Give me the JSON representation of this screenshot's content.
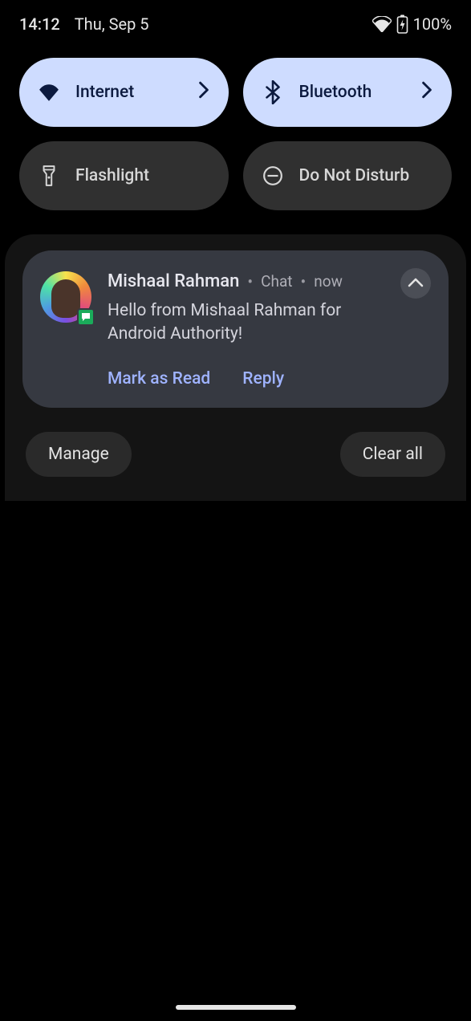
{
  "status": {
    "time": "14:12",
    "date": "Thu, Sep 5",
    "battery": "100%"
  },
  "qs": {
    "internet": "Internet",
    "bluetooth": "Bluetooth",
    "flashlight": "Flashlight",
    "dnd": "Do Not Disturb"
  },
  "notif": {
    "sender": "Mishaal Rahman",
    "app": "Chat",
    "time": "now",
    "body": "Hello from Mishaal Rahman for Android Authority!",
    "actions": {
      "mark_read": "Mark as Read",
      "reply": "Reply"
    }
  },
  "footer": {
    "manage": "Manage",
    "clear_all": "Clear all"
  }
}
